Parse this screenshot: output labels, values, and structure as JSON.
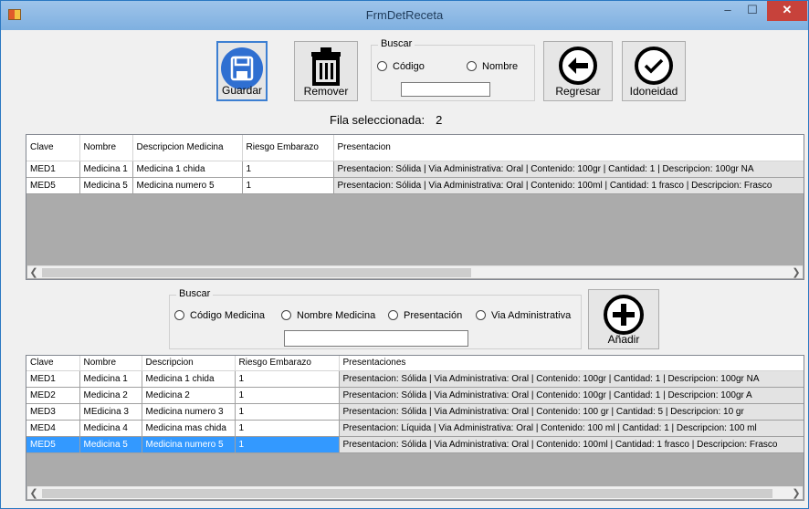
{
  "window": {
    "title": "FrmDetReceta"
  },
  "toolbar": {
    "guardar": "Guardar",
    "remover": "Remover",
    "regresar": "Regresar",
    "idoneidad": "Idoneidad",
    "buscar_title": "Buscar",
    "radio_codigo": "Código",
    "radio_nombre": "Nombre",
    "search_value": ""
  },
  "status": {
    "label": "Fila seleccionada:",
    "value": "2"
  },
  "top_grid": {
    "headers": [
      "Clave",
      "Nombre",
      "Descripcion Medicina",
      "Riesgo Embarazo",
      "Presentacion"
    ],
    "rows": [
      [
        "MED1",
        "Medicina 1",
        "Medicina 1 chida",
        "1",
        "Presentacion: Sólida | Via Administrativa: Oral | Contenido: 100gr | Cantidad: 1 | Descripcion: 100gr NA"
      ],
      [
        "MED5",
        "Medicina 5",
        "Medicina numero 5",
        "1",
        "Presentacion: Sólida | Via Administrativa: Oral | Contenido: 100ml | Cantidad: 1 frasco | Descripcion: Frasco"
      ]
    ]
  },
  "search2": {
    "title": "Buscar",
    "radio_codigo": "Código Medicina",
    "radio_nombre": "Nombre Medicina",
    "radio_presentacion": "Presentación",
    "radio_via": "Via Administrativa",
    "value": "",
    "add_label": "Añadir"
  },
  "bottom_grid": {
    "headers": [
      "Clave",
      "Nombre",
      "Descripcion",
      "Riesgo Embarazo",
      "Presentaciones"
    ],
    "selected_index": 4,
    "rows": [
      [
        "MED1",
        "Medicina 1",
        "Medicina 1 chida",
        "1",
        "Presentacion: Sólida | Via Administrativa: Oral | Contenido: 100gr | Cantidad: 1 | Descripcion: 100gr NA"
      ],
      [
        "MED2",
        "Medicina 2",
        "Medicina 2",
        "1",
        "Presentacion: Sólida | Via Administrativa: Oral | Contenido: 100gr | Cantidad: 1 | Descripcion: 100gr A"
      ],
      [
        "MED3",
        "MEdicina 3",
        "Medicina numero 3",
        "1",
        "Presentacion: Sólida | Via Administrativa: Oral | Contenido: 100 gr | Cantidad: 5 | Descripcion: 10 gr"
      ],
      [
        "MED4",
        "Medicina 4",
        "Medicina mas chida",
        "1",
        "Presentacion: Líquida | Via Administrativa: Oral | Contenido: 100 ml | Cantidad: 1 | Descripcion: 100 ml"
      ],
      [
        "MED5",
        "Medicina 5",
        "Medicina numero 5",
        "1",
        "Presentacion: Sólida | Via Administrativa: Oral | Contenido: 100ml | Cantidad: 1 frasco | Descripcion: Frasco"
      ]
    ]
  },
  "icons": {
    "app": "app-icon",
    "save": "floppy-disk-icon",
    "remove": "trash-icon",
    "back": "arrow-left-icon",
    "check": "check-circle-icon",
    "add": "plus-circle-icon"
  },
  "colors": {
    "selection": "#3399ff",
    "titlebar": "#9ec4ea",
    "close": "#c7423b",
    "save_button": "#2f6fd1"
  }
}
